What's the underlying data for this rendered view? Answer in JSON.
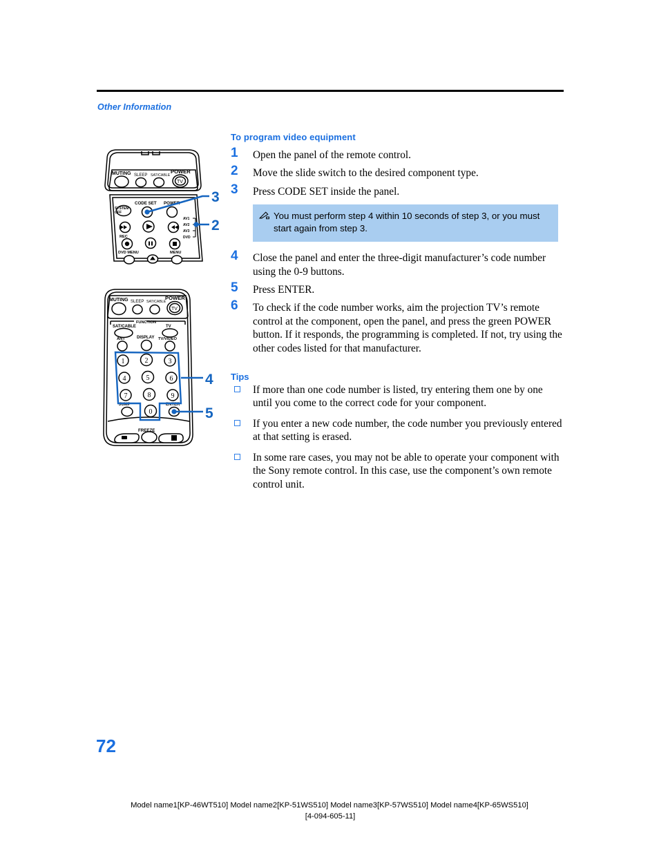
{
  "page": {
    "running_head": "Other Information",
    "page_number": "72"
  },
  "section": {
    "heading": "To program video equipment",
    "steps": [
      {
        "num": "1",
        "text": "Open the panel of the remote control."
      },
      {
        "num": "2",
        "text": "Move the slide switch to the desired component type."
      },
      {
        "num": "3",
        "text": "Press CODE SET inside the panel."
      },
      {
        "num": "4",
        "text": "Close the panel and enter the three-digit manufacturer’s code number using the 0-9 buttons."
      },
      {
        "num": "5",
        "text": "Press ENTER."
      },
      {
        "num": "6",
        "text": "To check if the code number works, aim the projection TV’s remote control at the component, open the panel, and press the green POWER button. If it responds, the programming is completed. If not, try using the other codes listed for that manufacturer."
      }
    ]
  },
  "note": {
    "icon": "pencil-note-icon",
    "text": "You must perform step 4 within 10 seconds of step 3, or you must start again from step 3.",
    "background_color": "#a9cdf0"
  },
  "tips": {
    "heading": "Tips",
    "items": [
      "If more than one code number is listed, try entering them one by one until you come to the correct code for your component.",
      "If you enter a new code number, the code number you previously entered at that setting is erased.",
      "In some rare cases, you may not be able to operate your component with the Sony remote control. In this case, use the component’s own remote control unit."
    ]
  },
  "illustrations": {
    "remote_top": {
      "name": "remote-control-panel-open",
      "callouts": [
        {
          "label": "3",
          "points_to": "CODE SET button"
        },
        {
          "label": "2",
          "points_to": "slide switch AV1/AV2/AV3/DVD"
        }
      ],
      "upper_buttons": [
        "MUTING",
        "SLEEP",
        "SAT/CABLE",
        "POWER",
        "TV"
      ],
      "inner_panel_labels": [
        "SYSTEM OFF",
        "CODE SET",
        "POWER",
        "REC",
        "DVD MENU",
        "MENU"
      ],
      "slide_switch_positions": [
        "AV1",
        "AV2",
        "AV3",
        "DVD"
      ]
    },
    "remote_bottom": {
      "name": "remote-control-panel-closed",
      "callouts": [
        {
          "label": "4",
          "points_to": "0-9 number buttons"
        },
        {
          "label": "5",
          "points_to": "ENTER button"
        }
      ],
      "upper_buttons": [
        "MUTING",
        "SLEEP",
        "SAT/CABLE",
        "POWER",
        "TV"
      ],
      "function_label": "FUNCTION",
      "function_buttons": [
        "SAT/CABLE",
        "TV"
      ],
      "row_buttons": [
        "ANT",
        "DISPLAY",
        "TV/VIDEO"
      ],
      "keypad": [
        "1",
        "2",
        "3",
        "4",
        "5",
        "6",
        "7",
        "8",
        "9",
        "0"
      ],
      "keypad_side_labels": [
        "JUMP",
        "ENTER"
      ],
      "bottom_label": "FREEZE"
    }
  },
  "footer": {
    "line1": "Model name1[KP-46WT510] Model name2[KP-51WS510] Model name3[KP-57WS510] Model name4[KP-65WS510]",
    "line2": "[4-094-605-11]"
  },
  "colors": {
    "accent_blue": "#1a6fe0",
    "note_blue": "#a9cdf0",
    "callout_blue": "#1565c0"
  }
}
